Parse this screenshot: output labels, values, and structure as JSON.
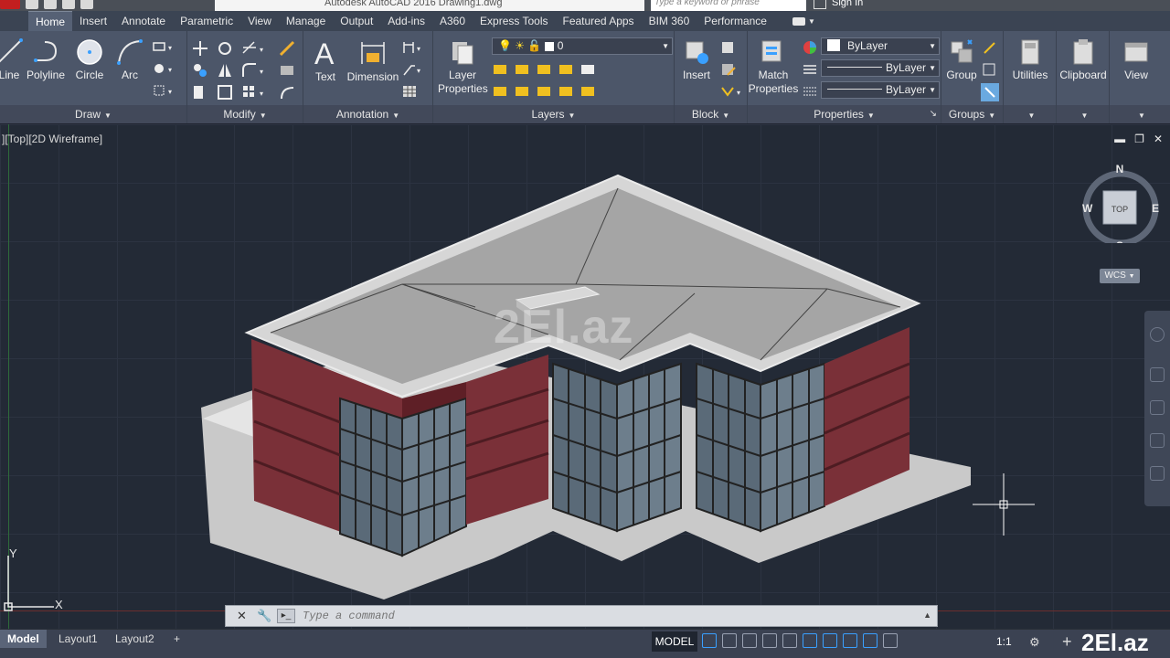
{
  "title_bar": {
    "document_title": "Autodesk AutoCAD 2016    Drawing1.dwg",
    "search_placeholder": "Type a keyword or phrase",
    "sign_in": "Sign In"
  },
  "ribbon_tabs": [
    "Home",
    "Insert",
    "Annotate",
    "Parametric",
    "View",
    "Manage",
    "Output",
    "Add-ins",
    "A360",
    "Express Tools",
    "Featured Apps",
    "BIM 360",
    "Performance"
  ],
  "ribbon": {
    "draw": {
      "label": "Draw",
      "tools": [
        "Line",
        "Polyline",
        "Circle",
        "Arc"
      ]
    },
    "modify": {
      "label": "Modify"
    },
    "annotation": {
      "label": "Annotation",
      "tools": [
        "Text",
        "Dimension"
      ]
    },
    "layers": {
      "label": "Layers",
      "layer_properties": "Layer Properties",
      "current_layer": "0"
    },
    "block": {
      "label": "Block",
      "insert": "Insert"
    },
    "properties": {
      "label": "Properties",
      "match": "Match Properties",
      "color": "ByLayer",
      "linetype": "ByLayer",
      "lineweight": "ByLayer"
    },
    "groups": {
      "label": "Groups",
      "group": "Group"
    },
    "utilities": "Utilities",
    "clipboard": "Clipboard",
    "view": "View"
  },
  "viewport": {
    "label": "][Top][2D Wireframe]",
    "viewcube": {
      "face": "TOP",
      "north": "N",
      "south": "S",
      "east": "E",
      "west": "W"
    },
    "wcs": "WCS",
    "ucs": {
      "x": "X",
      "y": "Y"
    },
    "watermark": "2El.az"
  },
  "command_line": {
    "placeholder": "Type a command"
  },
  "status_bar": {
    "layout_tabs": [
      "Model",
      "Layout1",
      "Layout2"
    ],
    "add_tab": "+",
    "model_button": "MODEL",
    "scale": "1:1",
    "brand": "2El.az"
  },
  "colors": {
    "ribbon_bg": "#4c5669",
    "viewport_bg": "#232a36",
    "brick": "#7a3038",
    "roof": "#a5a5a5",
    "accent_blue": "#3aa0ff"
  }
}
